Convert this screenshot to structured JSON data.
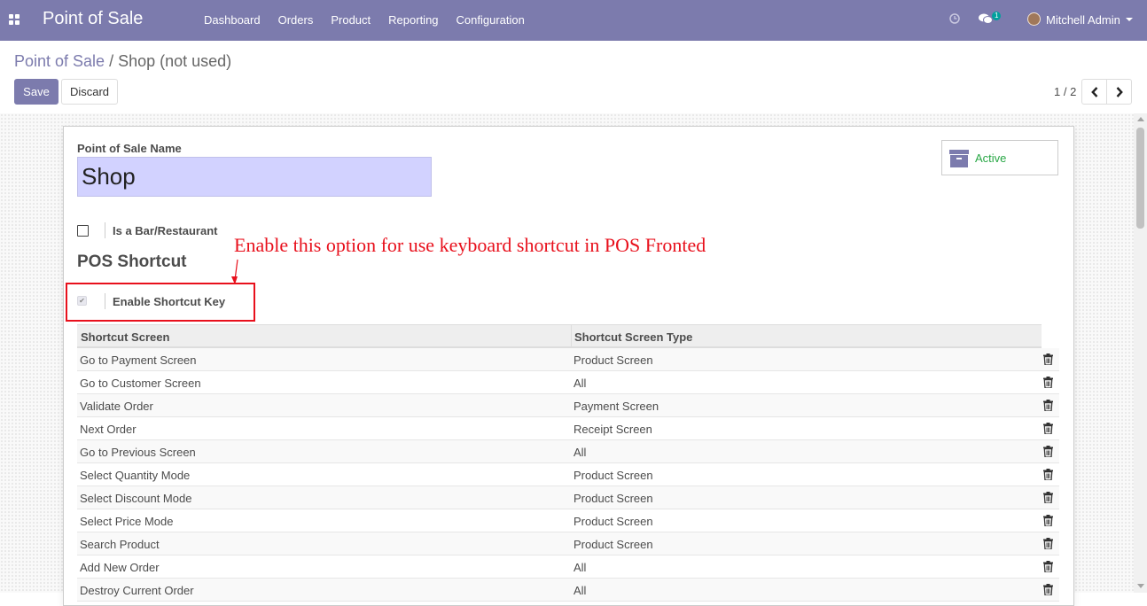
{
  "navbar": {
    "brand": "Point of Sale",
    "menu": [
      "Dashboard",
      "Orders",
      "Product",
      "Reporting",
      "Configuration"
    ],
    "chat_count": "1",
    "user": "Mitchell Admin",
    "bg_color": "#7c7bad"
  },
  "breadcrumb": {
    "parent": "Point of Sale",
    "separator": "/",
    "current": "Shop (not used)"
  },
  "buttons": {
    "save": "Save",
    "discard": "Discard"
  },
  "pager": {
    "value": "1 / 2"
  },
  "form": {
    "name_label": "Point of Sale Name",
    "name_value": "Shop",
    "active_label": "Active",
    "bar_label": "Is a Bar/Restaurant",
    "bar_checked": false,
    "section_title": "POS Shortcut",
    "shortcut_label": "Enable Shortcut Key",
    "shortcut_checked": true,
    "shortcut_check_glyph": "✔"
  },
  "annotation": {
    "text": "Enable this option for use keyboard shortcut in POS Fronted",
    "color": "#e8101c"
  },
  "table": {
    "columns": [
      "Shortcut Screen",
      "Shortcut Screen Type"
    ],
    "rows": [
      [
        "Go to Payment Screen",
        "Product Screen"
      ],
      [
        "Go to Customer Screen",
        "All"
      ],
      [
        "Validate Order",
        "Payment Screen"
      ],
      [
        "Next Order",
        "Receipt Screen"
      ],
      [
        "Go to Previous Screen",
        "All"
      ],
      [
        "Select Quantity Mode",
        "Product Screen"
      ],
      [
        "Select Discount Mode",
        "Product Screen"
      ],
      [
        "Select Price Mode",
        "Product Screen"
      ],
      [
        "Search Product",
        "Product Screen"
      ],
      [
        "Add New Order",
        "All"
      ],
      [
        "Destroy Current Order",
        "All"
      ]
    ]
  }
}
